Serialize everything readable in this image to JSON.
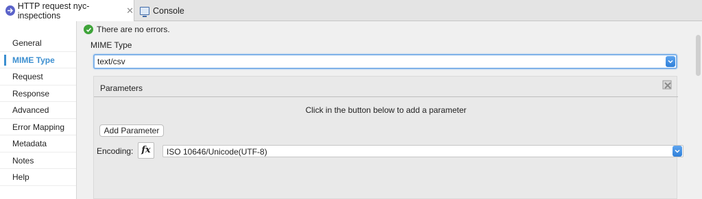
{
  "tabs": [
    {
      "label": "HTTP request nyc-inspections",
      "icon": "http-request-icon",
      "active": true
    },
    {
      "label": "Console",
      "icon": "console-icon",
      "active": false
    }
  ],
  "sidebar": {
    "items": [
      {
        "label": "General"
      },
      {
        "label": "MIME Type",
        "active": true
      },
      {
        "label": "Request"
      },
      {
        "label": "Response"
      },
      {
        "label": "Advanced"
      },
      {
        "label": "Error Mapping"
      },
      {
        "label": "Metadata"
      },
      {
        "label": "Notes"
      },
      {
        "label": "Help"
      }
    ]
  },
  "main": {
    "status_text": "There are no errors.",
    "section_label": "MIME Type",
    "mime_value": "text/csv",
    "parameters_title": "Parameters",
    "parameters_hint": "Click in the button below to add a parameter",
    "add_parameter_label": "Add Parameter",
    "encoding_label": "Encoding:",
    "fx_label": "fx",
    "encoding_value": "ISO 10646/Unicode(UTF-8)"
  },
  "colors": {
    "accent": "#3c8fd0",
    "ok": "#3fa43a",
    "dropdown": "#2f7fd8"
  }
}
